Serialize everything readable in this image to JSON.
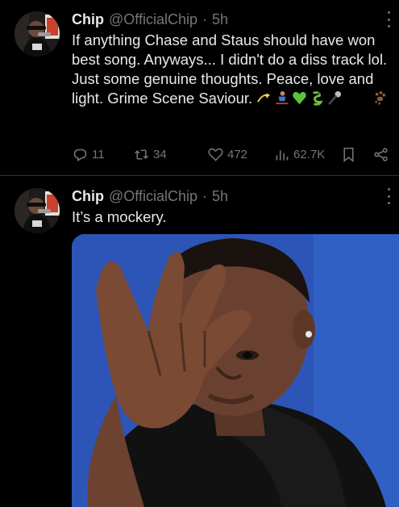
{
  "tweets": [
    {
      "author": {
        "name": "Chip",
        "handle": "@OfficialChip"
      },
      "separator": "·",
      "time": "5h",
      "text": "If anything Chase and Staus should have won best song. Anyways... I didn't do a diss track lol. Just some genuine thoughts. Peace, love and light. Grime Scene Saviour. ",
      "emojis": [
        "dizzy-emoji",
        "sledding-emoji",
        "green-heart-emoji",
        "dragon-emoji",
        "microphone-emoji",
        "paw-prints-emoji"
      ],
      "metrics": {
        "replies": "11",
        "retweets": "34",
        "likes": "472",
        "views": "62.7K"
      }
    },
    {
      "author": {
        "name": "Chip",
        "handle": "@OfficialChip"
      },
      "separator": "·",
      "time": "5h",
      "text": "It’s a mockery.",
      "media": {
        "alt_icon": "photo-man-hand-on-forehead",
        "background": "#2d55b7"
      }
    }
  ],
  "icons": {
    "reply": "reply-icon",
    "retweet": "retweet-icon",
    "like": "heart-icon",
    "views": "views-icon",
    "bookmark": "bookmark-icon",
    "share": "share-icon",
    "more": "more-icon"
  },
  "colors": {
    "background": "#000000",
    "text": "#e7e9ea",
    "muted": "#71767b",
    "divider": "#2f3336"
  }
}
